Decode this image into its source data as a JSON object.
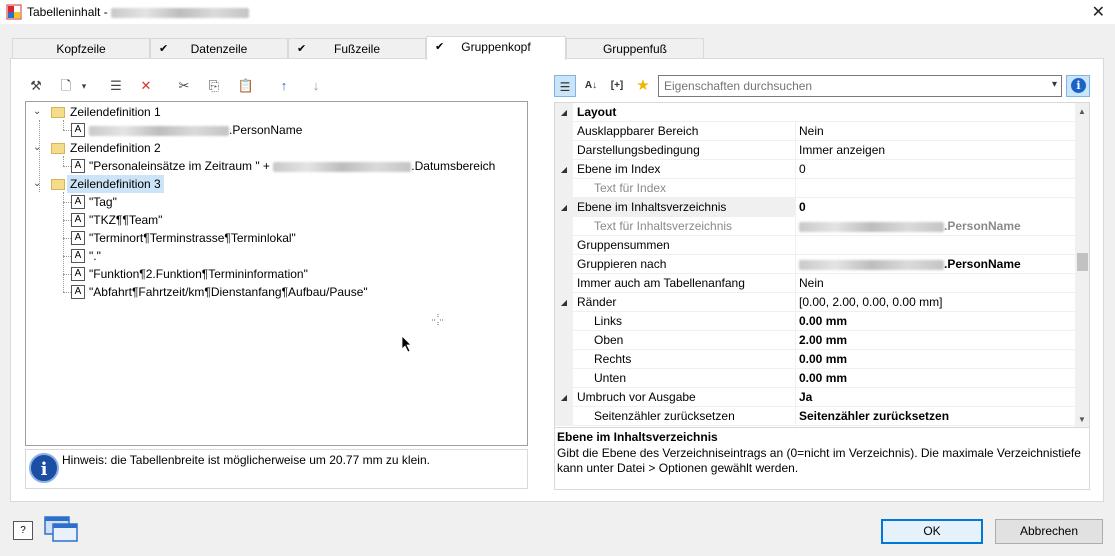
{
  "window": {
    "title_prefix": "Tabelleninhalt - ",
    "close_glyph": "✕"
  },
  "tabs": [
    {
      "label": "Kopfzeile",
      "checked": false,
      "active": false
    },
    {
      "label": "Datenzeile",
      "checked": true,
      "active": false
    },
    {
      "label": "Fußzeile",
      "checked": true,
      "active": false
    },
    {
      "label": "Gruppenkopf",
      "checked": true,
      "active": true
    },
    {
      "label": "Gruppenfuß",
      "checked": false,
      "active": false
    }
  ],
  "check_glyph": "✔",
  "tree": {
    "def1": {
      "label": "Zeilendefinition  1",
      "child": ".PersonName"
    },
    "def2": {
      "label": "Zeilendefinition  2",
      "child_pre": "\"Personaleinsätze im Zeitraum \" + ",
      "child_post": ".Datumsbereich"
    },
    "def3": {
      "label": "Zeilendefinition  3",
      "children": [
        "\"Tag\"",
        "\"TKZ¶¶Team\"",
        "\"Terminort¶Terminstrasse¶Terminlokal\"",
        "\".\"",
        "\"Funktion¶2.Funktion¶Termininformation\"",
        "\"Abfahrt¶Fahrtzeit/km¶Dienstanfang¶Aufbau/Pause\""
      ]
    }
  },
  "hint": {
    "text": "Hinweis: die Tabellenbreite ist möglicherweise um 20.77 mm zu klein."
  },
  "search": {
    "placeholder": "Eigenschaften durchsuchen"
  },
  "properties": {
    "section": "Layout",
    "rows": [
      {
        "name": "Ausklappbarer Bereich",
        "value": "Nein"
      },
      {
        "name": "Darstellungsbedingung",
        "value": "Immer anzeigen"
      },
      {
        "name": "Ebene im Index",
        "value": "0"
      },
      {
        "name": "Text für Index",
        "value": ""
      },
      {
        "name": "Ebene im Inhaltsverzeichnis",
        "value": "0"
      },
      {
        "name": "Text für Inhaltsverzeichnis",
        "value": ".PersonName"
      },
      {
        "name": "Gruppensummen",
        "value": ""
      },
      {
        "name": "Gruppieren nach",
        "value": ".PersonName"
      },
      {
        "name": "Immer auch am Tabellenanfang",
        "value": "Nein"
      },
      {
        "name": "Ränder",
        "value": "[0.00, 2.00, 0.00, 0.00 mm]"
      },
      {
        "name": "Links",
        "value": "0.00 mm"
      },
      {
        "name": "Oben",
        "value": "2.00 mm"
      },
      {
        "name": "Rechts",
        "value": "0.00 mm"
      },
      {
        "name": "Unten",
        "value": "0.00 mm"
      },
      {
        "name": "Umbruch vor Ausgabe",
        "value": "Ja"
      },
      {
        "name": "Seitenzähler zurücksetzen",
        "value": "Seitenzähler zurücksetzen"
      }
    ]
  },
  "description": {
    "title": "Ebene im Inhaltsverzeichnis",
    "text": "Gibt die Ebene des Verzeichniseintrags an (0=nicht im Verzeichnis). Die maximale Verzeichnistiefe kann unter Datei > Optionen gewählt werden."
  },
  "buttons": {
    "ok": "OK",
    "cancel": "Abbrechen"
  },
  "icons": {
    "help": "?",
    "info": "i",
    "glyphs": {
      "wand": "⚒",
      "new": "🗋",
      "props": "☰",
      "delete": "✕",
      "cut": "✂",
      "copy": "⎘",
      "paste": "📋",
      "up": "↑",
      "down": "↓",
      "sort": "A↓",
      "expand": "[+]",
      "star": "★",
      "dropdown": "▾"
    }
  },
  "colors": {
    "accent": "#0078d7",
    "selection": "#cce4f7",
    "delete_red": "#d9332b",
    "arrow_blue": "#2b6cc4"
  }
}
